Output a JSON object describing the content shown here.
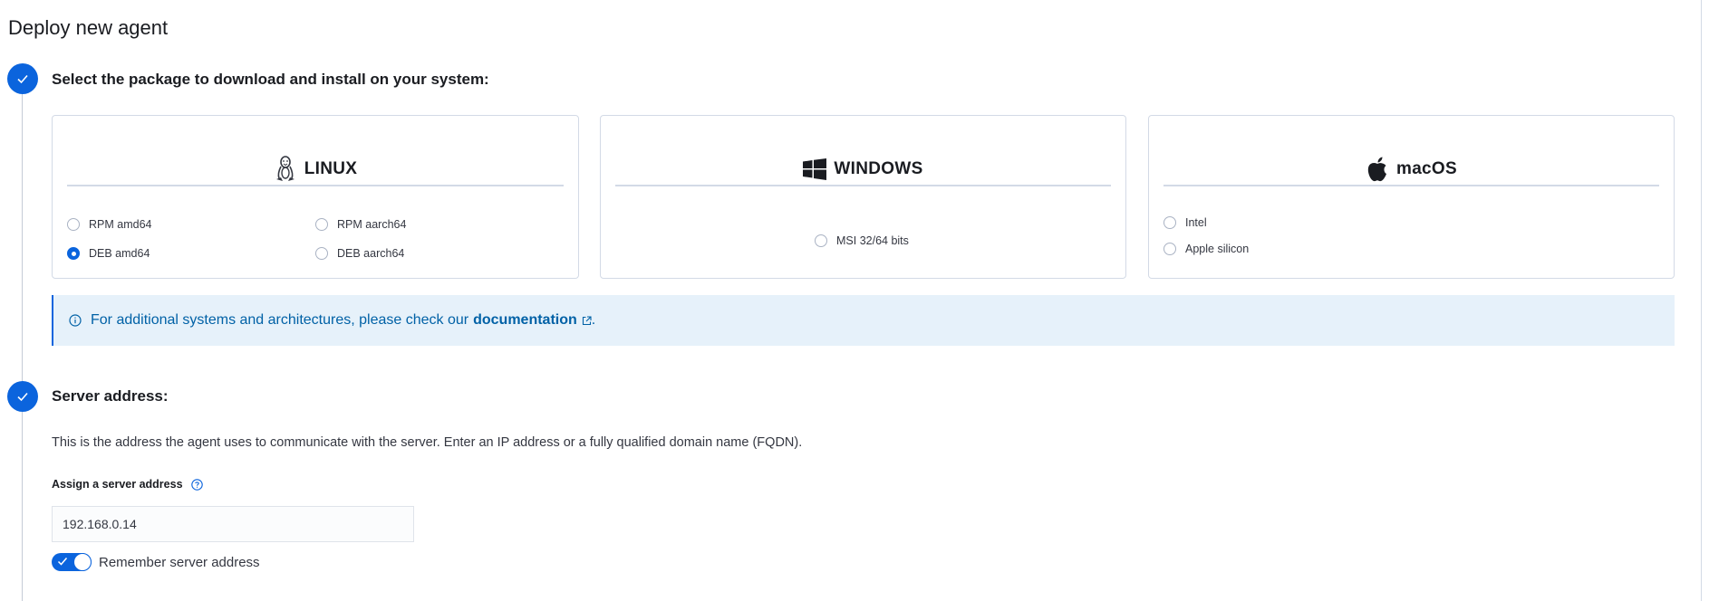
{
  "page": {
    "title": "Deploy new agent"
  },
  "steps": [
    {
      "title": "Select the package to download and install on your system:",
      "status": "complete"
    },
    {
      "title": "Server address:",
      "status": "complete"
    }
  ],
  "packages": {
    "linux": {
      "name": "LINUX",
      "icon": "linux-penguin-icon",
      "options": [
        {
          "label": "RPM amd64",
          "selected": false
        },
        {
          "label": "RPM aarch64",
          "selected": false
        },
        {
          "label": "DEB amd64",
          "selected": true
        },
        {
          "label": "DEB aarch64",
          "selected": false
        }
      ]
    },
    "windows": {
      "name": "WINDOWS",
      "icon": "windows-logo-icon",
      "options": [
        {
          "label": "MSI 32/64 bits",
          "selected": false
        }
      ]
    },
    "macos": {
      "name": "macOS",
      "icon": "apple-logo-icon",
      "options": [
        {
          "label": "Intel",
          "selected": false
        },
        {
          "label": "Apple silicon",
          "selected": false
        }
      ]
    }
  },
  "callout": {
    "text": "For additional systems and architectures, please check our",
    "link_label": "documentation",
    "suffix": "."
  },
  "server": {
    "description": "This is the address the agent uses to communicate with the server. Enter an IP address or a fully qualified domain name (FQDN).",
    "field_label": "Assign a server address",
    "value": "192.168.0.14",
    "remember_label": "Remember server address",
    "remember_enabled": true
  },
  "colors": {
    "accent": "#0b64dd",
    "callout_bg": "#e6f1fa",
    "link": "#0061a6"
  }
}
